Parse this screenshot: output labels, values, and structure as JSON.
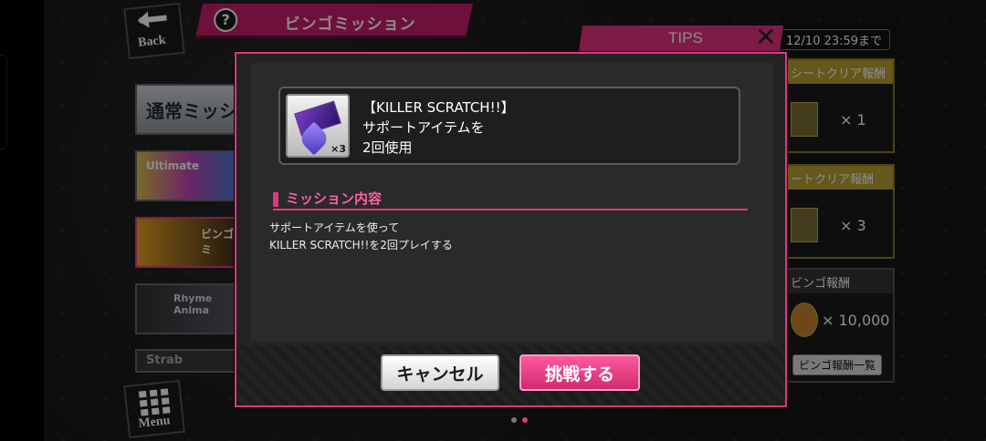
{
  "background": {
    "back_label": "Back",
    "menu_label": "Menu",
    "screen_title": "ビンゴミッション",
    "deadline": "12/10 23:59まで",
    "left_list": [
      {
        "label": "通常ミッシ"
      },
      {
        "label": "Ultimate"
      },
      {
        "label": "ビンゴミ"
      },
      {
        "label": "Rhyme Anima"
      },
      {
        "label": "Strab"
      }
    ],
    "right_cards": [
      {
        "header": "シートクリア報酬",
        "qty": "× 1"
      },
      {
        "header": "ートクリア報酬",
        "qty": "× 3"
      },
      {
        "header": "ビンゴ報酬",
        "qty": "× 10,000",
        "button": "ビンゴ報酬一覧"
      }
    ],
    "tips_label": "TIPS",
    "tips_close": "✕"
  },
  "modal": {
    "item": {
      "title": "【KILLER SCRATCH!!】",
      "desc_line1": "サポートアイテムを",
      "desc_line2": "2回使用",
      "count": "×3"
    },
    "section_title": "ミッション内容",
    "mission_line1": "サポートアイテムを使って",
    "mission_line2": "KILLER SCRATCH!!を2回プレイする",
    "cancel_label": "キャンセル",
    "accept_label": "挑戦する"
  },
  "colors": {
    "accent": "#e0377f",
    "gold": "#b8a030"
  }
}
